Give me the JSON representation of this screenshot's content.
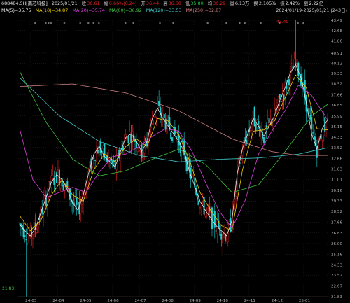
{
  "header": {
    "code_name": "688484.SH[南芯科技]",
    "date": "2025/01/21",
    "close_label": "收",
    "close_value": "36.61",
    "change_label": "幅",
    "change_value": "0.66%(0.24)",
    "open_label": "开",
    "open_value": "36.44",
    "high_label": "高",
    "high_value": "36.68",
    "low_label": "低",
    "low_value": "35.80",
    "avg_label": "均",
    "avg_value": "36.29",
    "volume_label": "量",
    "volume_value": "6.13万",
    "turnover_label": "换",
    "turnover_value": "2.105%",
    "amplitude_label": "振",
    "amplitude_value": "2.42%",
    "amount_label": "额",
    "amount_value": "2.22亿",
    "range_label": "2024/01/19-2025/01/21 (243日)"
  },
  "ma_legend": [
    {
      "label": "MA(5)=35.75",
      "color": "#e8e8e8"
    },
    {
      "label": "MA(10)=34.87",
      "color": "#f0d000"
    },
    {
      "label": "MA(20)=35.74",
      "color": "#e040e0"
    },
    {
      "label": "MA(60)=36.92",
      "color": "#40c040"
    },
    {
      "label": "MA(120)=33.53",
      "color": "#40c8c8"
    },
    {
      "label": "MA(250)=32.87",
      "color": "#d08080"
    }
  ],
  "annotations": {
    "high_marker": "43.49",
    "low_marker": "21.83"
  },
  "chart_data": {
    "type": "candlestick",
    "y_ticks": [
      "43.49",
      "42.68",
      "41.86",
      "40.91",
      "40.12",
      "39.33",
      "38.52",
      "37.66",
      "36.85",
      "35.99",
      "35.15",
      "34.33",
      "33.52",
      "32.66",
      "31.83",
      "31.01",
      "30.16",
      "29.33",
      "28.52",
      "27.66",
      "26.83",
      "26.00",
      "25.16",
      "24.33",
      "23.52",
      "22.67",
      "21.83"
    ],
    "y_range": [
      21.83,
      43.49
    ],
    "x_labels": [
      "24-03",
      "24-04",
      "24-05",
      "24-06",
      "24-07",
      "24-08",
      "24-09",
      "24-10",
      "24-11",
      "24-12",
      "25-01"
    ],
    "colors": {
      "up": "#e02020",
      "down": "#20d0d0"
    },
    "ma_lines": {
      "MA5": {
        "color": "#e8e8e8",
        "points": [
          [
            0,
            27.5
          ],
          [
            4,
            27.0
          ],
          [
            8,
            26.6
          ],
          [
            12,
            27.2
          ],
          [
            16,
            28.4
          ],
          [
            20,
            29.6
          ],
          [
            24,
            30.8
          ],
          [
            28,
            31.4
          ],
          [
            32,
            31.0
          ],
          [
            36,
            30.2
          ],
          [
            40,
            29.2
          ],
          [
            44,
            28.6
          ],
          [
            48,
            29.8
          ],
          [
            52,
            31.5
          ],
          [
            56,
            33.0
          ],
          [
            60,
            33.6
          ],
          [
            64,
            32.8
          ],
          [
            68,
            32.4
          ],
          [
            72,
            32.0
          ],
          [
            76,
            33.2
          ],
          [
            80,
            34.3
          ],
          [
            84,
            34.6
          ],
          [
            88,
            34.0
          ],
          [
            92,
            33.2
          ],
          [
            96,
            34.0
          ],
          [
            100,
            35.8
          ],
          [
            104,
            36.6
          ],
          [
            108,
            35.8
          ],
          [
            112,
            35.2
          ],
          [
            116,
            34.6
          ],
          [
            120,
            34.0
          ],
          [
            124,
            33.2
          ],
          [
            128,
            31.6
          ],
          [
            132,
            30.5
          ],
          [
            136,
            29.3
          ],
          [
            140,
            28.6
          ],
          [
            144,
            28.0
          ],
          [
            148,
            27.4
          ],
          [
            152,
            27.0
          ],
          [
            156,
            26.6
          ],
          [
            160,
            27.8
          ],
          [
            164,
            31.5
          ],
          [
            168,
            33.5
          ],
          [
            172,
            34.6
          ],
          [
            176,
            35.8
          ],
          [
            180,
            35.2
          ],
          [
            184,
            34.4
          ],
          [
            188,
            35.2
          ],
          [
            192,
            36.0
          ],
          [
            196,
            37.2
          ],
          [
            200,
            38.2
          ],
          [
            204,
            39.4
          ],
          [
            208,
            40.0
          ],
          [
            212,
            39.0
          ],
          [
            216,
            37.0
          ],
          [
            220,
            34.6
          ],
          [
            224,
            33.4
          ],
          [
            228,
            35.0
          ],
          [
            232,
            35.7
          ]
        ]
      },
      "MA10": {
        "color": "#f0d000",
        "points": [
          [
            0,
            28.2
          ],
          [
            8,
            27.0
          ],
          [
            16,
            27.8
          ],
          [
            24,
            29.8
          ],
          [
            32,
            31.0
          ],
          [
            40,
            29.8
          ],
          [
            48,
            29.3
          ],
          [
            56,
            31.8
          ],
          [
            64,
            33.0
          ],
          [
            72,
            32.4
          ],
          [
            80,
            33.6
          ],
          [
            88,
            34.2
          ],
          [
            96,
            33.6
          ],
          [
            104,
            35.8
          ],
          [
            112,
            35.6
          ],
          [
            120,
            34.5
          ],
          [
            128,
            32.5
          ],
          [
            136,
            30.0
          ],
          [
            144,
            28.6
          ],
          [
            152,
            27.4
          ],
          [
            160,
            27.0
          ],
          [
            168,
            31.8
          ],
          [
            176,
            34.8
          ],
          [
            184,
            34.9
          ],
          [
            192,
            35.6
          ],
          [
            200,
            37.4
          ],
          [
            208,
            39.2
          ],
          [
            216,
            38.2
          ],
          [
            224,
            35.0
          ],
          [
            232,
            34.9
          ]
        ]
      },
      "MA20": {
        "color": "#e040e0",
        "points": [
          [
            0,
            35.0
          ],
          [
            10,
            31.0
          ],
          [
            20,
            29.6
          ],
          [
            30,
            30.0
          ],
          [
            40,
            30.4
          ],
          [
            50,
            30.0
          ],
          [
            60,
            31.6
          ],
          [
            70,
            32.8
          ],
          [
            80,
            33.0
          ],
          [
            90,
            33.6
          ],
          [
            100,
            34.4
          ],
          [
            110,
            35.0
          ],
          [
            120,
            34.8
          ],
          [
            130,
            33.2
          ],
          [
            140,
            30.8
          ],
          [
            150,
            28.6
          ],
          [
            160,
            27.2
          ],
          [
            170,
            29.4
          ],
          [
            180,
            33.0
          ],
          [
            190,
            34.8
          ],
          [
            200,
            36.4
          ],
          [
            210,
            38.4
          ],
          [
            220,
            37.6
          ],
          [
            232,
            35.7
          ]
        ]
      },
      "MA60": {
        "color": "#40c040",
        "points": [
          [
            0,
            39.5
          ],
          [
            20,
            35.5
          ],
          [
            40,
            32.6
          ],
          [
            60,
            31.3
          ],
          [
            80,
            31.7
          ],
          [
            100,
            32.6
          ],
          [
            120,
            33.4
          ],
          [
            140,
            32.2
          ],
          [
            160,
            30.0
          ],
          [
            180,
            30.6
          ],
          [
            200,
            33.2
          ],
          [
            220,
            36.0
          ],
          [
            232,
            36.9
          ]
        ]
      },
      "MA120": {
        "color": "#40c8c8",
        "points": [
          [
            0,
            39.0
          ],
          [
            30,
            36.0
          ],
          [
            60,
            34.0
          ],
          [
            90,
            32.9
          ],
          [
            120,
            32.4
          ],
          [
            150,
            32.6
          ],
          [
            180,
            32.7
          ],
          [
            210,
            33.0
          ],
          [
            232,
            33.5
          ]
        ]
      },
      "MA250": {
        "color": "#d08080",
        "points": [
          [
            0,
            38.3
          ],
          [
            40,
            38.5
          ],
          [
            80,
            37.8
          ],
          [
            120,
            36.4
          ],
          [
            160,
            34.2
          ],
          [
            190,
            33.2
          ],
          [
            210,
            32.9
          ],
          [
            232,
            32.9
          ]
        ]
      }
    }
  }
}
